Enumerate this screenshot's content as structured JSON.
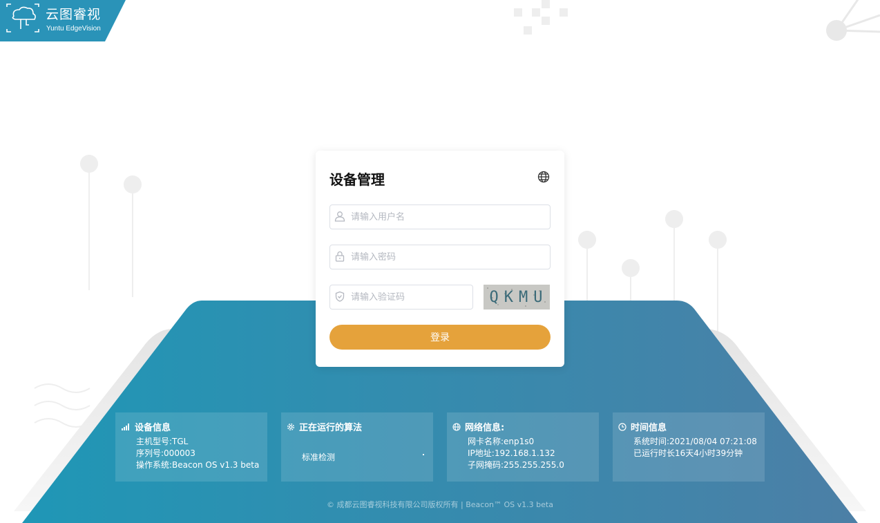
{
  "logo": {
    "title": "云图睿视",
    "subtitle": "Yuntu EdgeVision"
  },
  "login": {
    "title": "设备管理",
    "username_placeholder": "请输入用户名",
    "password_placeholder": "请输入密码",
    "captcha_placeholder": "请输入验证码",
    "captcha_text": "QKMU",
    "submit_label": "登录"
  },
  "panels": {
    "device": {
      "title": "设备信息",
      "lines": [
        "主机型号:TGL",
        "序列号:000003",
        "操作系统:Beacon OS v1.3 beta"
      ]
    },
    "algorithm": {
      "title": "正在运行的算法",
      "item": "标准检测"
    },
    "network": {
      "title": "网络信息:",
      "lines": [
        "网卡名称:enp1s0",
        "IP地址:192.168.1.132",
        "子网掩码:255.255.255.0"
      ]
    },
    "time": {
      "title": "时间信息",
      "lines": [
        "系统时间:2021/08/04 07:21:08",
        "已运行时长16天4小时39分钟"
      ]
    }
  },
  "footer": "© 成都云图睿视科技有限公司版权所有 | Beacon™ OS v1.3 beta",
  "colors": {
    "accent_button": "#e5a23b",
    "platform_left": "#1f97b6",
    "platform_right": "#4a82a8",
    "logo_bg": "#2a93b8"
  },
  "icons": {
    "language": "globe-icon",
    "username": "user-icon",
    "password": "lock-icon",
    "captcha": "shield-icon"
  }
}
